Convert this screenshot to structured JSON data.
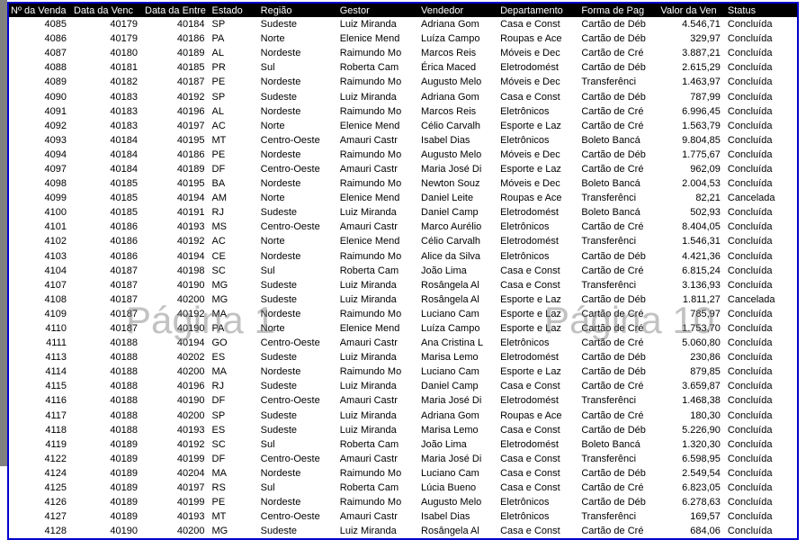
{
  "watermarks": {
    "page1": "Página 1",
    "page10": "Página 10"
  },
  "columns": [
    "Nº da Venda",
    "Data da Venc",
    "Data da Entre",
    "Estado",
    "Região",
    "Gestor",
    "Vendedor",
    "Departamento",
    "Forma de Pag",
    "Valor da Ven",
    "Status"
  ],
  "rows": [
    {
      "num": "4085",
      "venc": "40179",
      "entr": "40184",
      "uf": "SP",
      "reg": "Sudeste",
      "gest": "Luiz Miranda",
      "vend": "Adriana Gom",
      "dep": "Casa e Const",
      "fp": "Cartão de Déb",
      "val": "4.546,71",
      "st": "Concluída"
    },
    {
      "num": "4086",
      "venc": "40179",
      "entr": "40186",
      "uf": "PA",
      "reg": "Norte",
      "gest": "Elenice Mend",
      "vend": "Luíza Campo",
      "dep": "Roupas e Ace",
      "fp": "Cartão de Déb",
      "val": "329,97",
      "st": "Concluída"
    },
    {
      "num": "4087",
      "venc": "40180",
      "entr": "40189",
      "uf": "AL",
      "reg": "Nordeste",
      "gest": "Raimundo Mo",
      "vend": "Marcos Reis",
      "dep": "Móveis e Dec",
      "fp": "Cartão de Cré",
      "val": "3.887,21",
      "st": "Concluída"
    },
    {
      "num": "4088",
      "venc": "40181",
      "entr": "40185",
      "uf": "PR",
      "reg": "Sul",
      "gest": "Roberta Cam",
      "vend": "Érica Maced",
      "dep": "Eletrodomést",
      "fp": "Cartão de Déb",
      "val": "2.615,29",
      "st": "Concluída"
    },
    {
      "num": "4089",
      "venc": "40182",
      "entr": "40187",
      "uf": "PE",
      "reg": "Nordeste",
      "gest": "Raimundo Mo",
      "vend": "Augusto Melo",
      "dep": "Móveis e Dec",
      "fp": "Transferênci",
      "val": "1.463,97",
      "st": "Concluída"
    },
    {
      "num": "4090",
      "venc": "40183",
      "entr": "40192",
      "uf": "SP",
      "reg": "Sudeste",
      "gest": "Luiz Miranda",
      "vend": "Adriana Gom",
      "dep": "Casa e Const",
      "fp": "Cartão de Déb",
      "val": "787,99",
      "st": "Concluída"
    },
    {
      "num": "4091",
      "venc": "40183",
      "entr": "40196",
      "uf": "AL",
      "reg": "Nordeste",
      "gest": "Raimundo Mo",
      "vend": "Marcos Reis",
      "dep": "Eletrônicos",
      "fp": "Cartão de Cré",
      "val": "6.996,45",
      "st": "Concluída"
    },
    {
      "num": "4092",
      "venc": "40183",
      "entr": "40197",
      "uf": "AC",
      "reg": "Norte",
      "gest": "Elenice Mend",
      "vend": "Célio Carvalh",
      "dep": "Esporte e Laz",
      "fp": "Cartão de Cré",
      "val": "1.563,79",
      "st": "Concluída"
    },
    {
      "num": "4093",
      "venc": "40184",
      "entr": "40195",
      "uf": "MT",
      "reg": "Centro-Oeste",
      "gest": "Amauri Castr",
      "vend": "Isabel Dias",
      "dep": "Eletrônicos",
      "fp": "Boleto Bancá",
      "val": "9.804,85",
      "st": "Concluída"
    },
    {
      "num": "4094",
      "venc": "40184",
      "entr": "40186",
      "uf": "PE",
      "reg": "Nordeste",
      "gest": "Raimundo Mo",
      "vend": "Augusto Melo",
      "dep": "Móveis e Dec",
      "fp": "Cartão de Déb",
      "val": "1.775,67",
      "st": "Concluída"
    },
    {
      "num": "4097",
      "venc": "40184",
      "entr": "40189",
      "uf": "DF",
      "reg": "Centro-Oeste",
      "gest": "Amauri Castr",
      "vend": "Maria José Di",
      "dep": "Esporte e Laz",
      "fp": "Cartão de Cré",
      "val": "962,09",
      "st": "Concluída"
    },
    {
      "num": "4098",
      "venc": "40185",
      "entr": "40195",
      "uf": "BA",
      "reg": "Nordeste",
      "gest": "Raimundo Mo",
      "vend": "Newton Souz",
      "dep": "Móveis e Dec",
      "fp": "Boleto Bancá",
      "val": "2.004,53",
      "st": "Concluída"
    },
    {
      "num": "4099",
      "venc": "40185",
      "entr": "40194",
      "uf": "AM",
      "reg": "Norte",
      "gest": "Elenice Mend",
      "vend": "Daniel Leite",
      "dep": "Roupas e Ace",
      "fp": "Transferênci",
      "val": "82,21",
      "st": "Cancelada"
    },
    {
      "num": "4100",
      "venc": "40185",
      "entr": "40191",
      "uf": "RJ",
      "reg": "Sudeste",
      "gest": "Luiz Miranda",
      "vend": "Daniel Camp",
      "dep": "Eletrodomést",
      "fp": "Boleto Bancá",
      "val": "502,93",
      "st": "Concluída"
    },
    {
      "num": "4101",
      "venc": "40186",
      "entr": "40193",
      "uf": "MS",
      "reg": "Centro-Oeste",
      "gest": "Amauri Castr",
      "vend": "Marco Aurélio",
      "dep": "Eletrônicos",
      "fp": "Cartão de Cré",
      "val": "8.404,05",
      "st": "Concluída"
    },
    {
      "num": "4102",
      "venc": "40186",
      "entr": "40192",
      "uf": "AC",
      "reg": "Norte",
      "gest": "Elenice Mend",
      "vend": "Célio Carvalh",
      "dep": "Eletrodomést",
      "fp": "Transferênci",
      "val": "1.546,31",
      "st": "Concluída"
    },
    {
      "num": "4103",
      "venc": "40186",
      "entr": "40194",
      "uf": "CE",
      "reg": "Nordeste",
      "gest": "Raimundo Mo",
      "vend": "Alice da Silva",
      "dep": "Eletrônicos",
      "fp": "Cartão de Déb",
      "val": "4.421,36",
      "st": "Concluída"
    },
    {
      "num": "4104",
      "venc": "40187",
      "entr": "40198",
      "uf": "SC",
      "reg": "Sul",
      "gest": "Roberta Cam",
      "vend": "João Lima",
      "dep": "Casa e Const",
      "fp": "Cartão de Cré",
      "val": "6.815,24",
      "st": "Concluída"
    },
    {
      "num": "4107",
      "venc": "40187",
      "entr": "40190",
      "uf": "MG",
      "reg": "Sudeste",
      "gest": "Luiz Miranda",
      "vend": "Rosângela Al",
      "dep": "Casa e Const",
      "fp": "Transferênci",
      "val": "3.136,93",
      "st": "Concluída"
    },
    {
      "num": "4108",
      "venc": "40187",
      "entr": "40200",
      "uf": "MG",
      "reg": "Sudeste",
      "gest": "Luiz Miranda",
      "vend": "Rosângela Al",
      "dep": "Esporte e Laz",
      "fp": "Cartão de Déb",
      "val": "1.811,27",
      "st": "Cancelada"
    },
    {
      "num": "4109",
      "venc": "40187",
      "entr": "40192",
      "uf": "MA",
      "reg": "Nordeste",
      "gest": "Raimundo Mo",
      "vend": "Luciano Cam",
      "dep": "Esporte e Laz",
      "fp": "Cartão de Cré",
      "val": "785,97",
      "st": "Concluída"
    },
    {
      "num": "4110",
      "venc": "40187",
      "entr": "40190",
      "uf": "PA",
      "reg": "Norte",
      "gest": "Elenice Mend",
      "vend": "Luíza Campo",
      "dep": "Esporte e Laz",
      "fp": "Cartão de Cré",
      "val": "1.753,70",
      "st": "Concluída"
    },
    {
      "num": "4111",
      "venc": "40188",
      "entr": "40194",
      "uf": "GO",
      "reg": "Centro-Oeste",
      "gest": "Amauri Castr",
      "vend": "Ana Cristina L",
      "dep": "Eletrônicos",
      "fp": "Cartão de Cré",
      "val": "5.060,80",
      "st": "Concluída"
    },
    {
      "num": "4113",
      "venc": "40188",
      "entr": "40202",
      "uf": "ES",
      "reg": "Sudeste",
      "gest": "Luiz Miranda",
      "vend": "Marisa Lemo",
      "dep": "Eletrodomést",
      "fp": "Cartão de Déb",
      "val": "230,86",
      "st": "Concluída"
    },
    {
      "num": "4114",
      "venc": "40188",
      "entr": "40200",
      "uf": "MA",
      "reg": "Nordeste",
      "gest": "Raimundo Mo",
      "vend": "Luciano Cam",
      "dep": "Esporte e Laz",
      "fp": "Cartão de Déb",
      "val": "879,85",
      "st": "Concluída"
    },
    {
      "num": "4115",
      "venc": "40188",
      "entr": "40196",
      "uf": "RJ",
      "reg": "Sudeste",
      "gest": "Luiz Miranda",
      "vend": "Daniel Camp",
      "dep": "Casa e Const",
      "fp": "Cartão de Cré",
      "val": "3.659,87",
      "st": "Concluída"
    },
    {
      "num": "4116",
      "venc": "40188",
      "entr": "40190",
      "uf": "DF",
      "reg": "Centro-Oeste",
      "gest": "Amauri Castr",
      "vend": "Maria José Di",
      "dep": "Eletrodomést",
      "fp": "Transferênci",
      "val": "1.468,38",
      "st": "Concluída"
    },
    {
      "num": "4117",
      "venc": "40188",
      "entr": "40200",
      "uf": "SP",
      "reg": "Sudeste",
      "gest": "Luiz Miranda",
      "vend": "Adriana Gom",
      "dep": "Roupas e Ace",
      "fp": "Cartão de Cré",
      "val": "180,30",
      "st": "Concluída"
    },
    {
      "num": "4118",
      "venc": "40188",
      "entr": "40193",
      "uf": "ES",
      "reg": "Sudeste",
      "gest": "Luiz Miranda",
      "vend": "Marisa Lemo",
      "dep": "Casa e Const",
      "fp": "Cartão de Déb",
      "val": "5.226,90",
      "st": "Concluída"
    },
    {
      "num": "4119",
      "venc": "40189",
      "entr": "40192",
      "uf": "SC",
      "reg": "Sul",
      "gest": "Roberta Cam",
      "vend": "João Lima",
      "dep": "Eletrodomést",
      "fp": "Boleto Bancá",
      "val": "1.320,30",
      "st": "Concluída"
    },
    {
      "num": "4122",
      "venc": "40189",
      "entr": "40199",
      "uf": "DF",
      "reg": "Centro-Oeste",
      "gest": "Amauri Castr",
      "vend": "Maria José Di",
      "dep": "Casa e Const",
      "fp": "Transferênci",
      "val": "6.598,95",
      "st": "Concluída"
    },
    {
      "num": "4124",
      "venc": "40189",
      "entr": "40204",
      "uf": "MA",
      "reg": "Nordeste",
      "gest": "Raimundo Mo",
      "vend": "Luciano Cam",
      "dep": "Casa e Const",
      "fp": "Cartão de Déb",
      "val": "2.549,54",
      "st": "Concluída"
    },
    {
      "num": "4125",
      "venc": "40189",
      "entr": "40197",
      "uf": "RS",
      "reg": "Sul",
      "gest": "Roberta Cam",
      "vend": "Lúcia Bueno",
      "dep": "Casa e Const",
      "fp": "Cartão de Cré",
      "val": "6.823,05",
      "st": "Concluída"
    },
    {
      "num": "4126",
      "venc": "40189",
      "entr": "40199",
      "uf": "PE",
      "reg": "Nordeste",
      "gest": "Raimundo Mo",
      "vend": "Augusto Melo",
      "dep": "Eletrônicos",
      "fp": "Cartão de Déb",
      "val": "6.278,63",
      "st": "Concluída"
    },
    {
      "num": "4127",
      "venc": "40189",
      "entr": "40193",
      "uf": "MT",
      "reg": "Centro-Oeste",
      "gest": "Amauri Castr",
      "vend": "Isabel Dias",
      "dep": "Eletrônicos",
      "fp": "Transferênci",
      "val": "169,57",
      "st": "Concluída"
    },
    {
      "num": "4128",
      "venc": "40190",
      "entr": "40200",
      "uf": "MG",
      "reg": "Sudeste",
      "gest": "Luiz Miranda",
      "vend": "Rosângela Al",
      "dep": "Casa e Const",
      "fp": "Cartão de Cré",
      "val": "684,06",
      "st": "Concluída"
    }
  ]
}
